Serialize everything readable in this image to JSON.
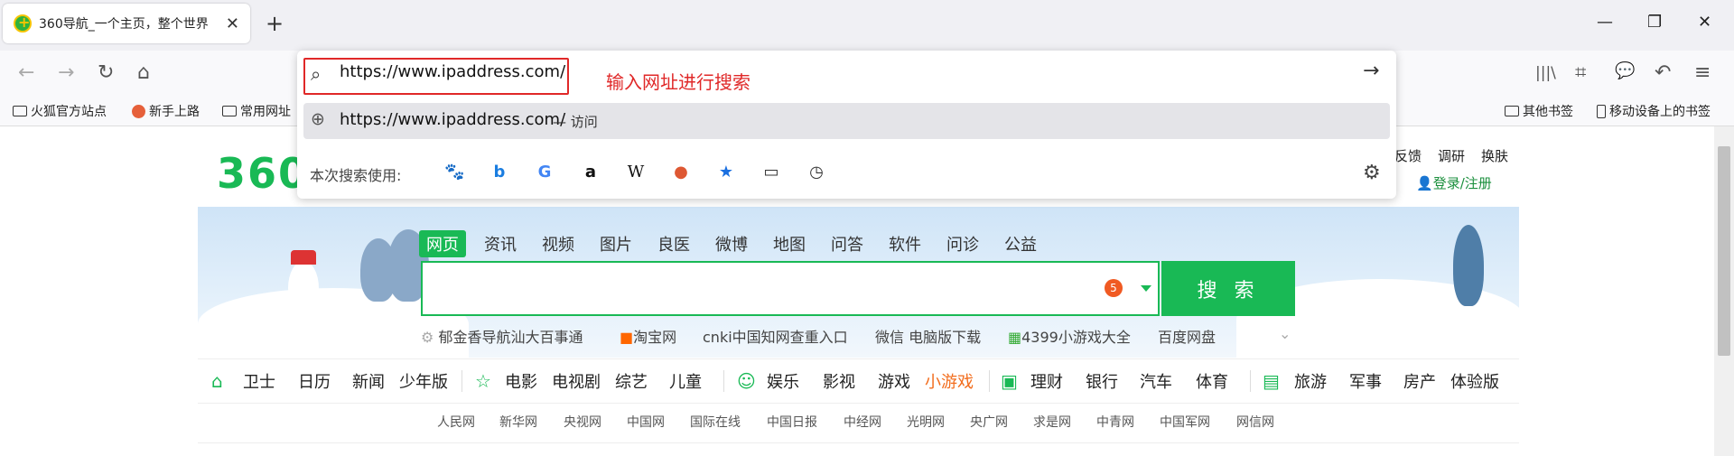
{
  "tab": {
    "title": "360导航_一个主页，整个世界",
    "close": "✕"
  },
  "new_tab_label": "+",
  "window_controls": {
    "minimize": "—",
    "maximize": "❐",
    "close": "✕"
  },
  "nav": {
    "back": "←",
    "forward": "→",
    "reload": "↻",
    "home": "⌂"
  },
  "toolbar_icons": {
    "library": "|||\\",
    "crop": "⌗",
    "chat": "💬",
    "undo": "↶",
    "menu": "≡"
  },
  "bookmarks": {
    "left": [
      "火狐官方站点",
      "新手上路",
      "常用网址"
    ],
    "right": [
      "其他书签",
      "移动设备上的书签"
    ]
  },
  "url_dropdown": {
    "url": "https://www.ipaddress.com/",
    "hint": "输入网址进行搜索",
    "suggestion_url": "https://www.ipaddress.com/",
    "suggestion_action": "— 访问",
    "engines_label": "本次搜索使用:",
    "engines": [
      "baidu-icon",
      "bing-icon",
      "google-icon",
      "amazon-icon",
      "wikipedia-icon",
      "duckduckgo-icon",
      "bookmarks-icon",
      "tabs-icon",
      "history-icon"
    ],
    "engine_glyphs": [
      "🐾",
      "b",
      "G",
      "a",
      "W",
      "●",
      "★",
      "▭",
      "◷"
    ]
  },
  "page": {
    "logo": "360",
    "top_links": [
      "反馈",
      "调研",
      "换肤"
    ],
    "login": "登录/注册",
    "search_tabs": [
      "网页",
      "资讯",
      "视频",
      "图片",
      "良医",
      "微博",
      "地图",
      "问答",
      "软件",
      "问诊",
      "公益"
    ],
    "search_button": "搜 索",
    "search_badge": "5",
    "hot_links": [
      "郁金香导航汕大百事通",
      "淘宝网",
      "cnki中国知网查重入口",
      "微信 电脑版下载",
      "4399小游戏大全",
      "百度网盘"
    ],
    "cat_nav": [
      "卫士",
      "日历",
      "新闻",
      "少年版",
      "电影",
      "电视剧",
      "综艺",
      "儿童",
      "娱乐",
      "影视",
      "游戏",
      "小游戏",
      "理财",
      "银行",
      "汽车",
      "体育",
      "旅游",
      "军事",
      "房产",
      "体验版"
    ],
    "media_links": [
      "人民网",
      "新华网",
      "央视网",
      "中国网",
      "国际在线",
      "中国日报",
      "中经网",
      "光明网",
      "央广网",
      "求是网",
      "中青网",
      "中国军网",
      "网信网"
    ]
  },
  "colors": {
    "brand_green": "#19b955",
    "accent_red": "#e02828",
    "orange": "#f26c1c"
  }
}
